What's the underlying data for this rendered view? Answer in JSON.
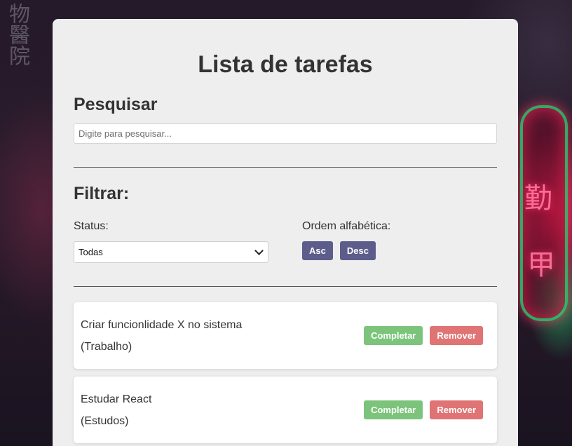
{
  "app": {
    "title": "Lista de tarefas"
  },
  "search": {
    "title": "Pesquisar",
    "placeholder": "Digite para pesquisar...",
    "value": ""
  },
  "filter": {
    "title": "Filtrar:",
    "status_label": "Status:",
    "status_selected": "Todas",
    "order_label": "Ordem alfabética:",
    "asc_label": "Asc",
    "desc_label": "Desc"
  },
  "tasks": [
    {
      "text": "Criar funcionlidade X no sistema",
      "category": "(Trabalho)",
      "complete_label": "Completar",
      "remove_label": "Remover"
    },
    {
      "text": "Estudar React",
      "category": "(Estudos)",
      "complete_label": "Completar",
      "remove_label": "Remover"
    }
  ],
  "colors": {
    "card_bg": "#eeeeee",
    "sort_button": "#5d5d8c",
    "complete_button": "#7cc47b",
    "remove_button": "#e07474"
  }
}
